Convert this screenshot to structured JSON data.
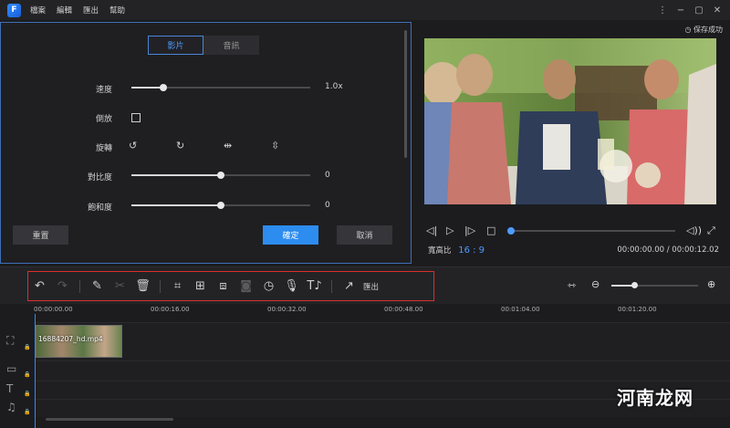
{
  "app": {
    "logo_glyph": "F",
    "menu": [
      "檔案",
      "編輯",
      "匯出",
      "幫助"
    ],
    "window_controls": [
      "more-icon",
      "minimize-icon",
      "maximize-icon",
      "close-icon"
    ]
  },
  "edit_panel": {
    "tabs": [
      {
        "label": "影片",
        "active": true
      },
      {
        "label": "音訊",
        "active": false
      }
    ],
    "speed": {
      "label": "速度",
      "value_text": "1.0x",
      "level": 0.18
    },
    "reverse": {
      "label": "倒放",
      "checked": false
    },
    "rotate": {
      "label": "旋轉",
      "icons": [
        "rotate-left-icon",
        "rotate-right-icon",
        "flip-horizontal-icon",
        "flip-vertical-icon"
      ]
    },
    "contrast": {
      "label": "對比度",
      "value_text": "0",
      "level": 0.5
    },
    "saturation": {
      "label": "飽和度",
      "value_text": "0",
      "level": 0.5
    },
    "reset_label": "重置",
    "ok_label": "確定",
    "cancel_label": "取消"
  },
  "preview": {
    "save_status": "保存成功",
    "aspect_label": "寬高比",
    "aspect_value": "16 : 9",
    "timecode": "00:00:00.00 / 00:00:12.02",
    "progress": 0.0
  },
  "toolbar": {
    "tools": [
      "undo-icon",
      "redo-icon",
      "edit-icon",
      "cut-icon",
      "delete-icon",
      "crop-icon",
      "add-frame-icon",
      "split-icon",
      "snapshot-icon",
      "duration-icon",
      "voiceover-icon",
      "text-to-speech-icon"
    ],
    "export_label": "匯出",
    "zoom_level": 0.27
  },
  "timeline": {
    "ruler_labels": [
      "00:00:00.00",
      "00:00:16.00",
      "00:00:32.00",
      "00:00:48.00",
      "00:01:04.00",
      "00:01:20.00"
    ],
    "clip": {
      "name": "16884207_hd.mp4"
    },
    "tracks": [
      "video-track-icon",
      "overlay-track-icon",
      "text-track-icon",
      "music-track-icon"
    ]
  },
  "watermark": "河南龙网",
  "colors": {
    "accent": "#2d8cf0",
    "highlight_box": "#d9302c",
    "panel_border": "#3f6fb6"
  }
}
